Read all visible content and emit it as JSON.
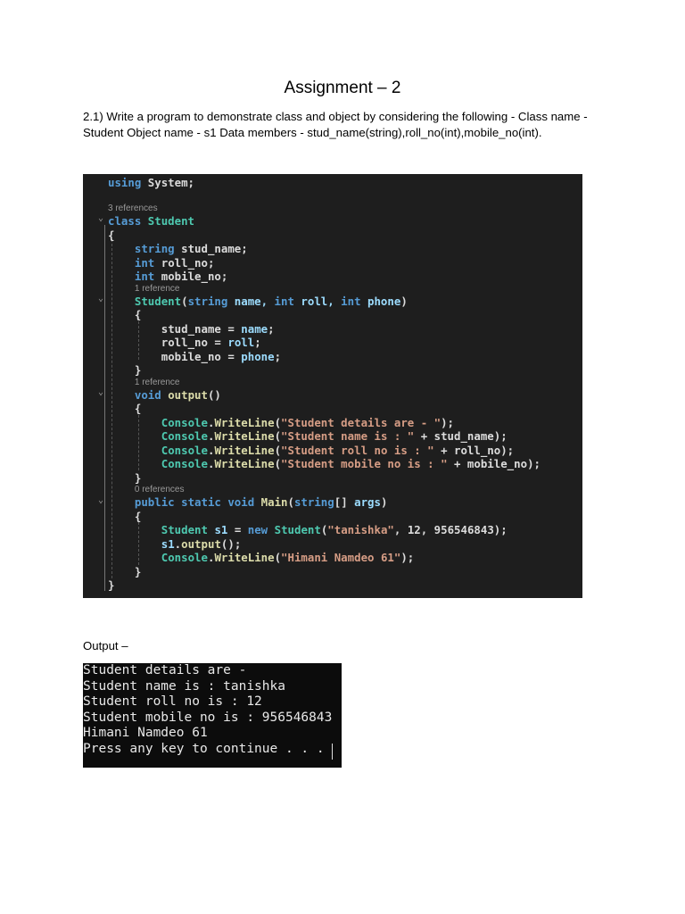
{
  "title": "Assignment – 2",
  "question": "2.1) Write a program to demonstrate class and object by considering the following - Class name - Student Object name - s1 Data members - stud_name(string),roll_no(int),mobile_no(int).",
  "code_lines": [
    {
      "indent": 0,
      "tokens": [
        [
          "using",
          "kw"
        ],
        [
          " ",
          "tx"
        ],
        [
          "System",
          "tx"
        ],
        [
          ";",
          "tx"
        ]
      ]
    },
    {
      "indent": 0,
      "tokens": []
    },
    {
      "indent": 0,
      "ref": "3 references"
    },
    {
      "indent": 0,
      "tokens": [
        [
          "class",
          "kw"
        ],
        [
          " ",
          "tx"
        ],
        [
          "Student",
          "ty"
        ]
      ]
    },
    {
      "indent": 0,
      "tokens": [
        [
          "{",
          "tx"
        ]
      ]
    },
    {
      "indent": 4,
      "tokens": [
        [
          "string",
          "kw"
        ],
        [
          " ",
          "tx"
        ],
        [
          "stud_name",
          "tx"
        ],
        [
          ";",
          "tx"
        ]
      ]
    },
    {
      "indent": 4,
      "tokens": [
        [
          "int",
          "kw"
        ],
        [
          " ",
          "tx"
        ],
        [
          "roll_no",
          "tx"
        ],
        [
          ";",
          "tx"
        ]
      ]
    },
    {
      "indent": 4,
      "tokens": [
        [
          "int",
          "kw"
        ],
        [
          " ",
          "tx"
        ],
        [
          "mobile_no",
          "tx"
        ],
        [
          ";",
          "tx"
        ]
      ]
    },
    {
      "indent": 4,
      "ref": "1 reference"
    },
    {
      "indent": 4,
      "tokens": [
        [
          "Student",
          "ty"
        ],
        [
          "(",
          "tx"
        ],
        [
          "string",
          "kw"
        ],
        [
          " name, ",
          "va"
        ],
        [
          "int",
          "kw"
        ],
        [
          " roll, ",
          "va"
        ],
        [
          "int",
          "kw"
        ],
        [
          " phone",
          "va"
        ],
        [
          ")",
          "tx"
        ]
      ]
    },
    {
      "indent": 4,
      "tokens": [
        [
          "{",
          "tx"
        ]
      ]
    },
    {
      "indent": 8,
      "tokens": [
        [
          "stud_name = ",
          "tx"
        ],
        [
          "name",
          "va"
        ],
        [
          ";",
          "tx"
        ]
      ]
    },
    {
      "indent": 8,
      "tokens": [
        [
          "roll_no = ",
          "tx"
        ],
        [
          "roll",
          "va"
        ],
        [
          ";",
          "tx"
        ]
      ]
    },
    {
      "indent": 8,
      "tokens": [
        [
          "mobile_no = ",
          "tx"
        ],
        [
          "phone",
          "va"
        ],
        [
          ";",
          "tx"
        ]
      ]
    },
    {
      "indent": 4,
      "tokens": [
        [
          "}",
          "tx"
        ]
      ]
    },
    {
      "indent": 4,
      "ref": "1 reference"
    },
    {
      "indent": 4,
      "tokens": [
        [
          "void",
          "kw"
        ],
        [
          " ",
          "tx"
        ],
        [
          "output",
          "fn"
        ],
        [
          "()",
          "tx"
        ]
      ]
    },
    {
      "indent": 4,
      "tokens": [
        [
          "{",
          "tx"
        ]
      ]
    },
    {
      "indent": 8,
      "tokens": [
        [
          "Console",
          "ty"
        ],
        [
          ".",
          "tx"
        ],
        [
          "WriteLine",
          "fn"
        ],
        [
          "(",
          "tx"
        ],
        [
          "\"Student details are - \"",
          "st"
        ],
        [
          ");",
          "tx"
        ]
      ]
    },
    {
      "indent": 8,
      "tokens": [
        [
          "Console",
          "ty"
        ],
        [
          ".",
          "tx"
        ],
        [
          "WriteLine",
          "fn"
        ],
        [
          "(",
          "tx"
        ],
        [
          "\"Student name is : \"",
          "st"
        ],
        [
          " + stud_name);",
          "tx"
        ]
      ]
    },
    {
      "indent": 8,
      "tokens": [
        [
          "Console",
          "ty"
        ],
        [
          ".",
          "tx"
        ],
        [
          "WriteLine",
          "fn"
        ],
        [
          "(",
          "tx"
        ],
        [
          "\"Student roll no is : \"",
          "st"
        ],
        [
          " + roll_no);",
          "tx"
        ]
      ]
    },
    {
      "indent": 8,
      "tokens": [
        [
          "Console",
          "ty"
        ],
        [
          ".",
          "tx"
        ],
        [
          "WriteLine",
          "fn"
        ],
        [
          "(",
          "tx"
        ],
        [
          "\"Student mobile no is : \"",
          "st"
        ],
        [
          " + mobile_no);",
          "tx"
        ]
      ]
    },
    {
      "indent": 4,
      "tokens": [
        [
          "}",
          "tx"
        ]
      ]
    },
    {
      "indent": 4,
      "ref": "0 references"
    },
    {
      "indent": 4,
      "tokens": [
        [
          "public",
          "kw"
        ],
        [
          " ",
          "tx"
        ],
        [
          "static",
          "kw"
        ],
        [
          " ",
          "tx"
        ],
        [
          "void",
          "kw"
        ],
        [
          " ",
          "tx"
        ],
        [
          "Main",
          "fn"
        ],
        [
          "(",
          "tx"
        ],
        [
          "string",
          "kw"
        ],
        [
          "[] ",
          "tx"
        ],
        [
          "args",
          "va"
        ],
        [
          ")",
          "tx"
        ]
      ]
    },
    {
      "indent": 4,
      "tokens": [
        [
          "{",
          "tx"
        ]
      ]
    },
    {
      "indent": 8,
      "tokens": [
        [
          "Student",
          "ty"
        ],
        [
          " ",
          "tx"
        ],
        [
          "s1",
          "va"
        ],
        [
          " = ",
          "tx"
        ],
        [
          "new",
          "kw"
        ],
        [
          " ",
          "tx"
        ],
        [
          "Student",
          "ty"
        ],
        [
          "(",
          "tx"
        ],
        [
          "\"tanishka\"",
          "st"
        ],
        [
          ", 12, 956546843);",
          "tx"
        ]
      ]
    },
    {
      "indent": 8,
      "tokens": [
        [
          "s1",
          "va"
        ],
        [
          ".",
          "tx"
        ],
        [
          "output",
          "fn"
        ],
        [
          "();",
          "tx"
        ]
      ]
    },
    {
      "indent": 8,
      "tokens": [
        [
          "Console",
          "ty"
        ],
        [
          ".",
          "tx"
        ],
        [
          "WriteLine",
          "fn"
        ],
        [
          "(",
          "tx"
        ],
        [
          "\"Himani Namdeo 61\"",
          "st"
        ],
        [
          ");",
          "tx"
        ]
      ]
    },
    {
      "indent": 4,
      "tokens": [
        [
          "}",
          "tx"
        ]
      ]
    },
    {
      "indent": 0,
      "tokens": [
        [
          "}",
          "tx"
        ]
      ]
    }
  ],
  "output_label": "Output –",
  "console_lines": [
    "Student details are -",
    "Student name is : tanishka",
    "Student roll no is : 12",
    "Student mobile no is : 956546843",
    "Himani Namdeo 61",
    "Press any key to continue . . ."
  ]
}
